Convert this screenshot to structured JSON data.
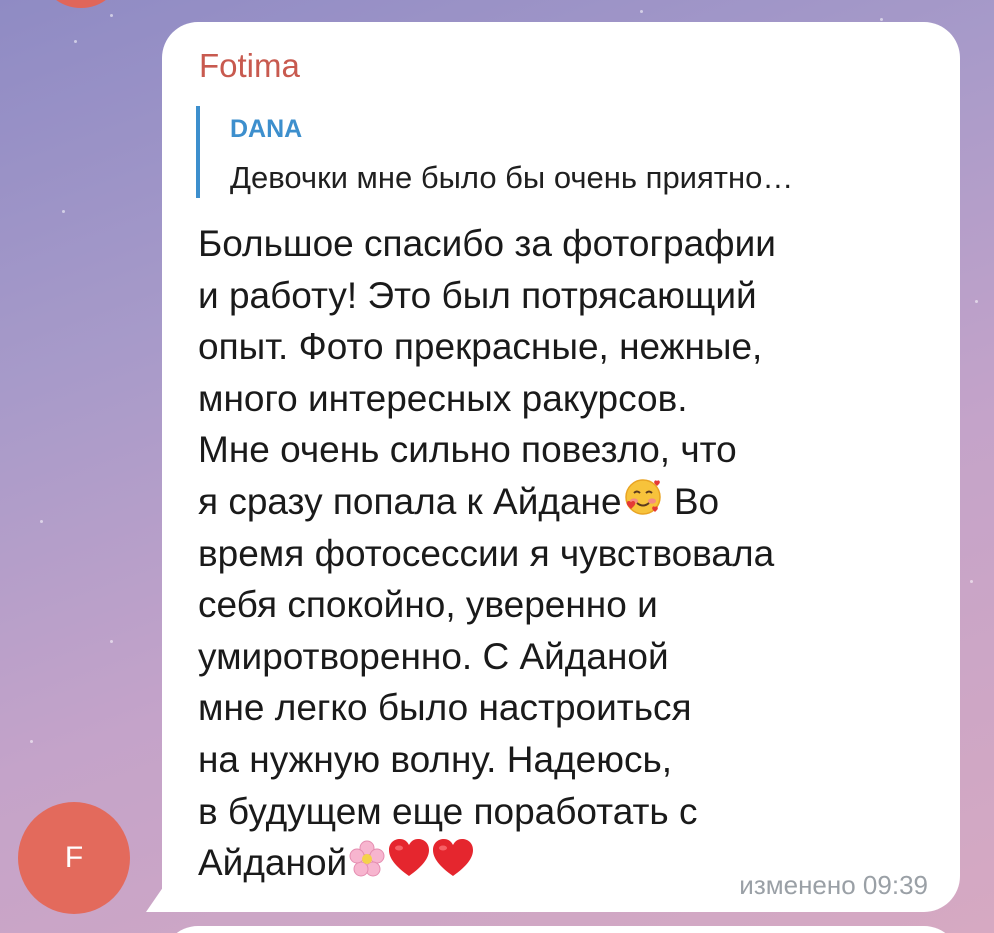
{
  "chat": {
    "avatar_letter": "F",
    "avatar_color": "#e36a5c",
    "message": {
      "sender": "Fotima",
      "sender_color": "#c85a4f",
      "reply": {
        "author": "DANA",
        "author_color": "#3d8fcd",
        "text": "Девочки мне было бы очень приятно…"
      },
      "lines": [
        "Большое спасибо за фотографии",
        "и работу! Это был потрясающий",
        "опыт. Фото прекрасные, нежные,",
        "много интересных ракурсов.",
        "Мне очень сильно повезло, что",
        "я сразу попала к Айдане",
        "Во",
        "время фотосессии я чувствовала",
        "себя спокойно, уверенно и",
        "умиротворенно. С Айданой",
        "мне легко было настроиться",
        "на нужную волну. Надеюсь,",
        "в будущем еще поработать с",
        "Айданой"
      ],
      "emojis": [
        "smiling-face-with-hearts-icon",
        "cherry-blossom-icon",
        "red-heart-icon",
        "red-heart-icon"
      ],
      "timestamp": "изменено 09:39"
    }
  }
}
